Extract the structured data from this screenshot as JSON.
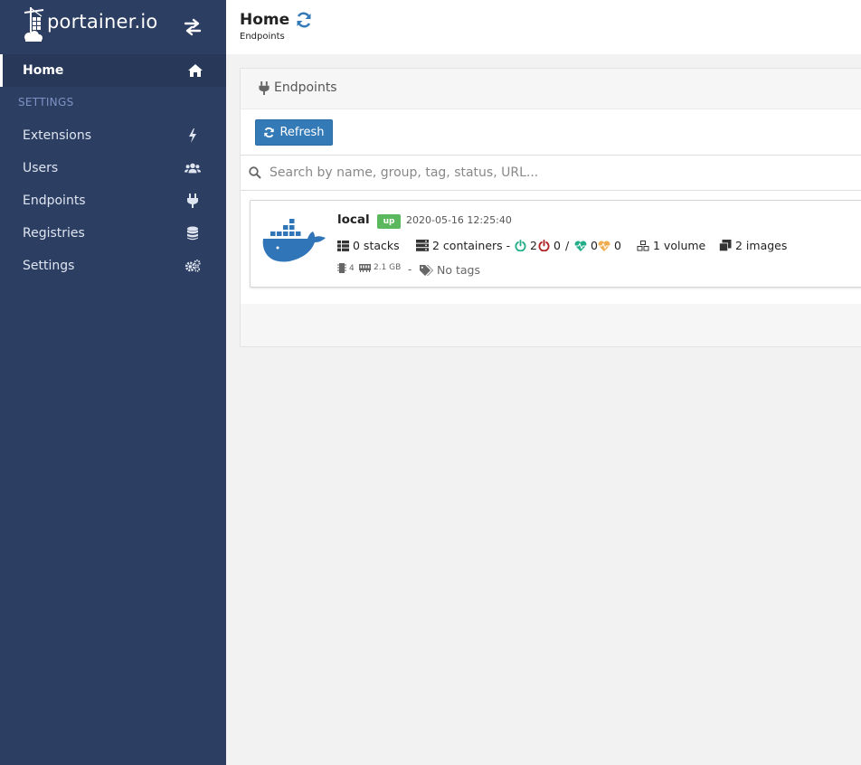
{
  "brand": {
    "name": "portainer.io"
  },
  "sidebar": {
    "home_label": "Home",
    "section_label": "SETTINGS",
    "items": [
      {
        "label": "Extensions",
        "icon": "bolt-icon"
      },
      {
        "label": "Users",
        "icon": "users-icon"
      },
      {
        "label": "Endpoints",
        "icon": "plug-icon"
      },
      {
        "label": "Registries",
        "icon": "database-icon"
      },
      {
        "label": "Settings",
        "icon": "cogs-icon"
      }
    ]
  },
  "header": {
    "title": "Home",
    "breadcrumb": "Endpoints"
  },
  "widget": {
    "title": "Endpoints",
    "refresh_label": "Refresh",
    "search_placeholder": "Search by name, group, tag, status, URL..."
  },
  "endpoint": {
    "name": "local",
    "status": "up",
    "timestamp": "2020-05-16 12:25:40",
    "stacks": "0 stacks",
    "containers": "2 containers",
    "separator": "-",
    "running": "2",
    "stopped": "0",
    "slash": "/",
    "healthy": "0",
    "unhealthy": "0",
    "volumes": "1 volume",
    "images": "2 images",
    "cpu": "4",
    "memory": "2.1 GB",
    "meta_separator": "-",
    "tags": "No tags"
  },
  "colors": {
    "sidebar_bg": "#2d3e63",
    "primary": "#337ab7",
    "success": "#5cb85c",
    "running_green": "#23ae89",
    "stopped_red": "#ae2323",
    "healthy_teal": "#23ae89",
    "unhealthy_orange": "#f0ad4e"
  }
}
